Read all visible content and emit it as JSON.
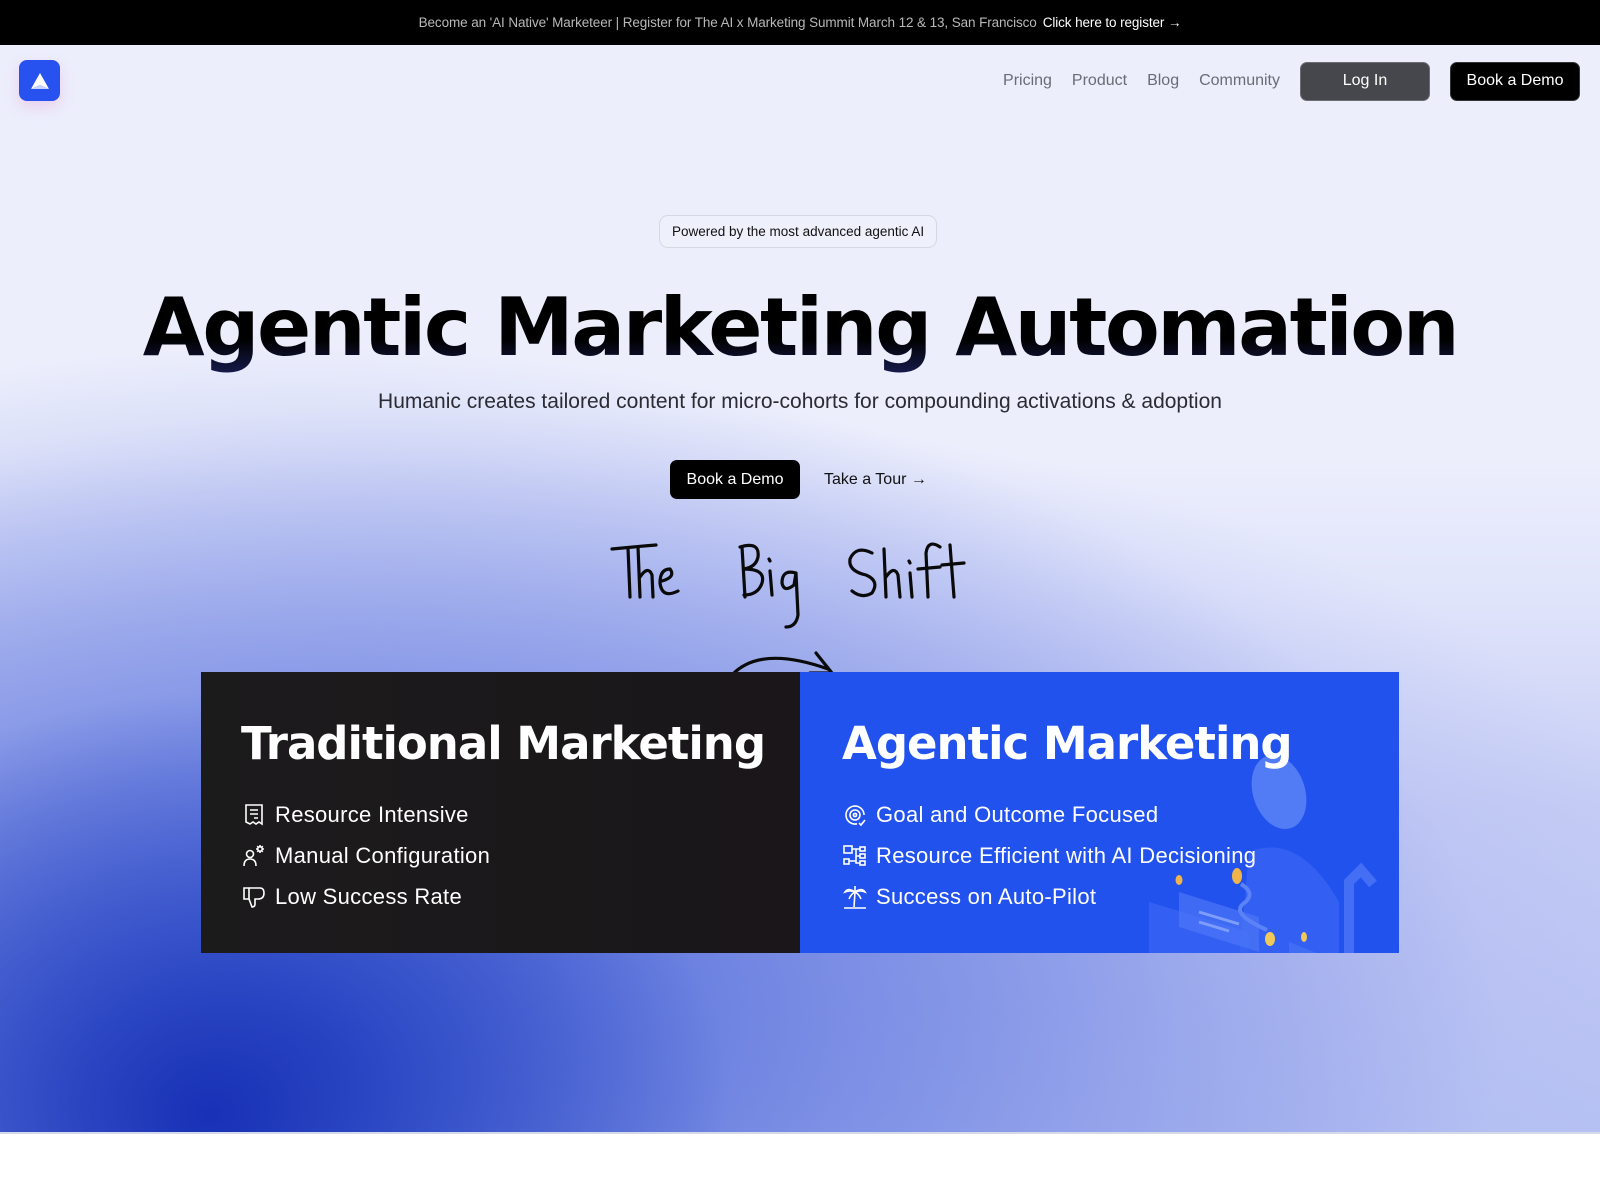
{
  "announcement": {
    "message": "Become an 'AI Native' Marketeer | Register for The AI x Marketing Summit March 12 & 13, San Francisco",
    "cta": "Click here to register →"
  },
  "header": {
    "logo_icon": "arrow-up-logo-icon",
    "nav": [
      "Pricing",
      "Product",
      "Blog",
      "Community"
    ],
    "login_label": "Log In",
    "demo_label": "Book a Demo"
  },
  "hero": {
    "pill": "Powered by the most advanced agentic AI",
    "title": "Agentic Marketing Automation",
    "subtitle": "Humanic creates tailored content for micro-cohorts for compounding activations & adoption",
    "primary_cta": "Book a Demo",
    "secondary_cta": "Take a Tour →",
    "handwritten": "The Big Shift"
  },
  "comparison": {
    "traditional": {
      "title": "Traditional Marketing",
      "items": [
        {
          "icon": "receipt-icon",
          "label": "Resource Intensive"
        },
        {
          "icon": "user-gear-icon",
          "label": "Manual Configuration"
        },
        {
          "icon": "thumbs-down-icon",
          "label": "Low Success Rate"
        }
      ]
    },
    "agentic": {
      "title": "Agentic Marketing",
      "items": [
        {
          "icon": "target-check-icon",
          "label": "Goal and Outcome Focused"
        },
        {
          "icon": "flowchart-icon",
          "label": "Resource Efficient with AI Decisioning"
        },
        {
          "icon": "palm-tree-icon",
          "label": "Success on Auto-Pilot"
        }
      ]
    }
  },
  "colors": {
    "brand_blue": "#2252ee",
    "dark_panel": "#1c1b1c",
    "announcement_bg": "#000000",
    "accent_gold": "#f0b44a"
  }
}
